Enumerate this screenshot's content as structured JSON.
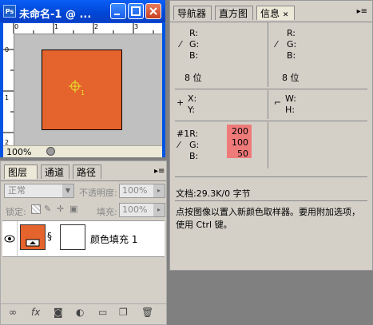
{
  "document_window": {
    "app_icon": "Ps",
    "title": "未命名-1 @ ...",
    "zoom": "100%",
    "ruler_top_marks": [
      "0",
      "1",
      "2",
      "3"
    ],
    "ruler_left_marks": [
      "0",
      "1",
      "2"
    ],
    "canvas_fill_color": "#e5632c",
    "sampler_number": "1"
  },
  "layers_panel": {
    "tabs": [
      "图层",
      "通道",
      "路径"
    ],
    "blend_mode": "正常",
    "opacity_label": "不透明度:",
    "opacity_value": "100%",
    "lock_label": "锁定:",
    "fill_label": "填充:",
    "fill_value": "100%",
    "layer_name": "颜色填充 1",
    "toolbar_icons": [
      "link-icon",
      "fx-icon",
      "mask-icon",
      "adjustment-icon",
      "group-folder-icon",
      "new-layer-icon",
      "trash-icon"
    ],
    "toolbar_fx": "fx"
  },
  "info_panel": {
    "tabs": [
      "导航器",
      "直方图",
      "信息"
    ],
    "rgb_left": {
      "r": "R:",
      "g": "G:",
      "b": "B:"
    },
    "rgb_right": {
      "r": "R:",
      "g": "G:",
      "b": "B:"
    },
    "bit_left": "8 位",
    "bit_right": "8 位",
    "xy": {
      "x": "X:",
      "y": "Y:"
    },
    "wh": {
      "w": "W:",
      "h": "H:"
    },
    "sampler": {
      "label": "#1R:",
      "g": "G:",
      "b": "B:",
      "r_value": "200",
      "g_value": "100",
      "b_value": "50"
    },
    "highlight_color": "#ef7a7a",
    "doc_size": "文档:29.3K/0 字节",
    "hint": "点按图像以置入新颜色取样器。要用附加选项，使用 Ctrl 键。"
  }
}
